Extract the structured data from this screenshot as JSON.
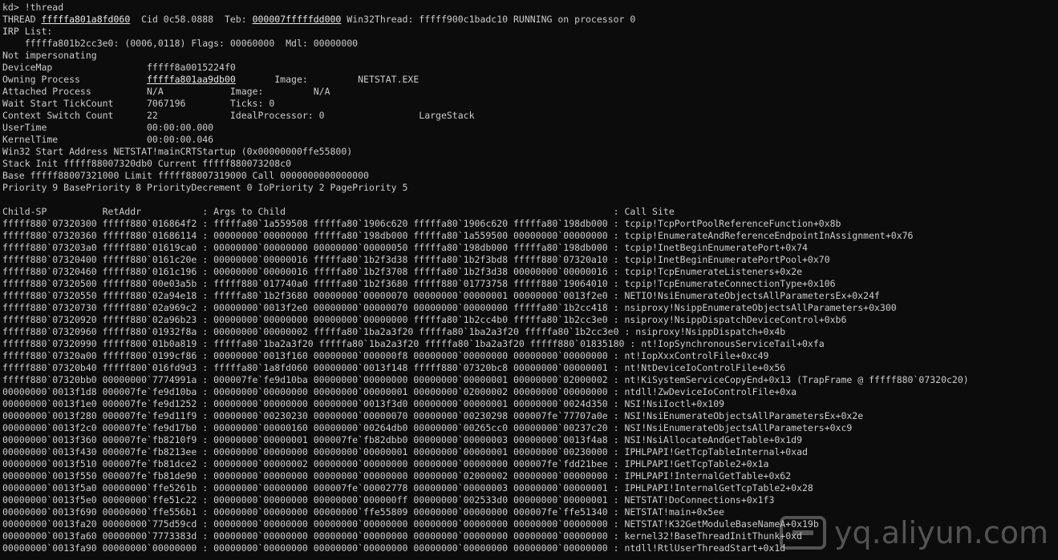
{
  "colors": {
    "background": "#0c0c0c",
    "text": "#cccccc"
  },
  "prompt": "kd> !thread",
  "thread_line": {
    "prefix": "THREAD ",
    "thread_addr": "fffffa801a8fd060",
    "mid": "  Cid 0c58.0888  Teb: ",
    "teb_addr": "000007fffffdd000",
    "suffix": " Win32Thread: fffff900c1badc10 RUNNING on processor 0"
  },
  "irp_lines": [
    "IRP List:",
    "    fffffa801b2cc3e0: (0006,0118) Flags: 00060000  Mdl: 00000000",
    "Not impersonating",
    "DeviceMap                 fffff8a0015224f0"
  ],
  "owning_line": {
    "prefix": "Owning Process            ",
    "process_addr": "fffffa801aa9db00",
    "suffix": "       Image:         NETSTAT.EXE"
  },
  "info_lines": [
    "Attached Process          N/A            Image:         N/A",
    "Wait Start TickCount      7067196        Ticks: 0",
    "Context Switch Count      22             IdealProcessor: 0                 LargeStack",
    "UserTime                  00:00:00.000",
    "KernelTime                00:00:00.046",
    "Win32 Start Address NETSTAT!mainCRTStartup (0x00000000ffe55800)",
    "Stack Init fffff88007320db0 Current fffff880073208c0",
    "Base fffff88007321000 Limit fffff88007319000 Call 0000000000000000",
    "Priority 9 BasePriority 8 PriorityDecrement 0 IoPriority 2 PagePriority 5",
    ""
  ],
  "stack_header": "Child-SP          RetAddr           : Args to Child                                                           : Call Site",
  "stack_lines": [
    "fffff880`07320300 fffff880`016864f2 : fffffa80`1a559508 fffffa80`1906c620 fffffa80`1906c620 fffffa80`198db000 : tcpip!TcpPortPoolReferenceFunction+0x8b",
    "fffff880`07320360 fffff880`01686114 : 00000000`00000000 fffffa80`198db000 fffffa80`1a559500 00000000`00000000 : tcpip!EnumerateAndReferenceEndpointInAssignment+0x76",
    "fffff880`073203a0 fffff880`01619ca0 : 00000000`00000000 00000000`00000050 fffffa80`198db000 fffffa80`198db000 : tcpip!InetBeginEnumeratePort+0x74",
    "fffff880`07320400 fffff880`0161c20e : 00000000`00000016 fffffa80`1b2f3d38 fffffa80`1b2f3bd8 fffff880`07320a10 : tcpip!InetBeginEnumeratePortPool+0x70",
    "fffff880`07320460 fffff880`0161c196 : 00000000`00000016 fffffa80`1b2f3708 fffffa80`1b2f3d38 00000000`00000016 : tcpip!TcpEnumerateListeners+0x2e",
    "fffff880`07320500 fffff880`00e03a5b : fffff880`017740a0 fffffa80`1b2f3680 fffff880`01773758 fffff880`19064010 : tcpip!TcpEnumerateConnectionType+0x106",
    "fffff880`07320550 fffff880`02a94e18 : fffffa80`1b2f3680 00000000`00000070 00000000`00000001 00000000`0013f2e0 : NETIO!NsiEnumerateObjectsAllParametersEx+0x24f",
    "fffff880`07320730 fffff880`02a969c2 : 00000000`0013f2e0 00000000`00000070 00000000`00000000 fffffa80`1b2cc418 : nsiproxy!NsippEnumerateObjectsAllParameters+0x300",
    "fffff880`07320920 fffff880`02a96b23 : 00000000`00000000 00000000`00000000 fffffa80`1b2cc4b0 fffffa80`1b2cc3e0 : nsiproxy!NsippDispatchDeviceControl+0xb6",
    "fffff880`07320960 fffff880`01932f8a : 00000000`00000002 fffffa80`1ba2a3f20 fffffa80`1ba2a3f20 fffffa80`1b2cc3e0 : nsiproxy!NsippDispatch+0x4b",
    "fffff880`07320990 fffff800`01b0a819 : fffffa80`1ba2a3f20 fffffa80`1ba2a3f20 fffffa80`1ba2a3f20 fffff880`01835180 : nt!IopSynchronousServiceTail+0xfa",
    "fffff880`07320a00 fffff800`0199cf86 : 00000000`0013f160 00000000`000000f8 00000000`00000000 00000000`00000000 : nt!IopXxxControlFile+0xc49",
    "fffff880`07320b40 fffff800`016fd9d3 : fffffa80`1a8fd060 00000000`0013f148 fffff880`07320bc8 00000000`00000001 : nt!NtDeviceIoControlFile+0x56",
    "fffff880`07320bb0 00000000`7774991a : 000007fe`fe9d10ba 00000000`00000000 00000000`00000001 00000000`02000002 : nt!KiSystemServiceCopyEnd+0x13 (TrapFrame @ fffff880`07320c20)",
    "00000000`0013f1d8 000007fe`fe9d10ba : 00000000`00000000 00000000`00000001 00000000`02000002 00000000`00000000 : ntdll!ZwDeviceIoControlFile+0xa",
    "00000000`0013f1e0 000007fe`fe9d1252 : 00000000`00000000 00000000`0013f3d0 00000000`00000001 00000000`0024d350 : NSI!NsiIoctl+0x109",
    "00000000`0013f280 000007fe`fe9d11f9 : 00000000`00230230 00000000`00000070 00000000`00230298 000007fe`77707a0e : NSI!NsiEnumerateObjectsAllParametersEx+0x2e",
    "00000000`0013f2c0 000007fe`fe9d17b0 : 00000000`00000160 00000000`00264db0 00000000`00265cc0 00000000`00237c20 : NSI!NsiEnumerateObjectsAllParameters+0xc9",
    "00000000`0013f360 000007fe`fb8210f9 : 00000000`00000001 000007fe`fb82dbb0 00000000`00000003 00000000`0013f4a8 : NSI!NsiAllocateAndGetTable+0x1d9",
    "00000000`0013f430 000007fe`fb8213ee : 00000000`00000000 00000000`00000001 00000000`00000001 00000000`00230000 : IPHLPAPI!GetTcpTableInternal+0xad",
    "00000000`0013f510 000007fe`fb81dce2 : 00000000`00000002 00000000`00000000 00000000`00000000 000007fe`fdd21bee : IPHLPAPI!GetTcpTable2+0x1a",
    "00000000`0013f550 000007fe`fb81de90 : 00000000`00000000 00000000`00000000 00000000`02000002 00000000`00000000 : IPHLPAPI!InternalGetTable+0x62",
    "00000000`0013f5a0 00000000`ffe5261b : 00000000`00000000 000007fe`00002778 00000000`00000003 00000000`00000001 : IPHLPAPI!InternalGetTcpTable2+0x28",
    "00000000`0013f5e0 00000000`ffe51c22 : 00000000`00000000 00000000`000000ff 00000000`002533d0 00000000`00000001 : NETSTAT!DoConnections+0x1f3",
    "00000000`0013f690 00000000`ffe556b1 : 00000000`00000000 00000000`ffe55809 00000000`00000000 000007fe`ffe51340 : NETSTAT!main+0x5ee",
    "00000000`0013fa20 00000000`775d59cd : 00000000`00000000 00000000`00000000 00000000`00000000 00000000`00000000 : NETSTAT!K32GetModuleBaseNameA+0x19b",
    "00000000`0013fa60 00000000`7773383d : 00000000`00000000 00000000`00000000 00000000`00000000 00000000`00000000 : kernel32!BaseThreadInitThunk+0xd",
    "00000000`0013fa90 00000000`00000000 : 00000000`00000000 00000000`00000000 00000000`00000000 00000000`00000000 : ntdll!RtlUserThreadStart+0x1d"
  ],
  "watermark": {
    "text": "yq.aliyun.com",
    "icon": "aliyun-logo-icon"
  }
}
